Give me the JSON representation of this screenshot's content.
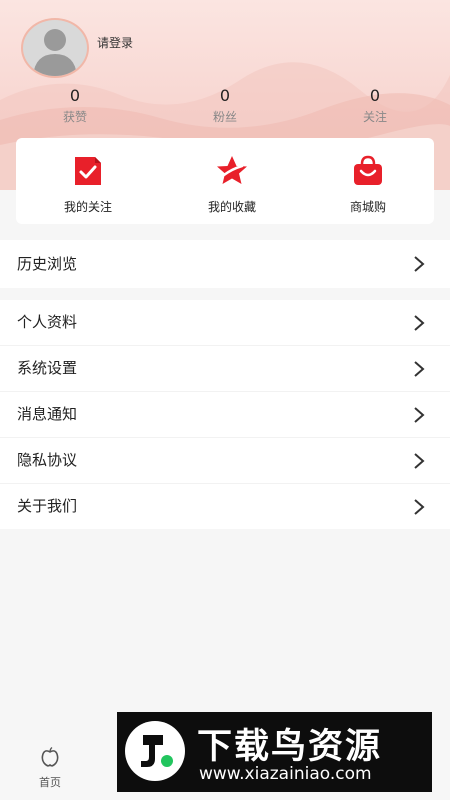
{
  "profile": {
    "login_prompt": "请登录"
  },
  "stats": [
    {
      "value": "0",
      "label": "获赞"
    },
    {
      "value": "0",
      "label": "粉丝"
    },
    {
      "value": "0",
      "label": "关注"
    }
  ],
  "quick_actions": [
    {
      "label": "我的关注",
      "icon": "check-document-icon"
    },
    {
      "label": "我的收藏",
      "icon": "star-icon"
    },
    {
      "label": "商城购",
      "icon": "shopping-bag-icon"
    }
  ],
  "history": {
    "label": "历史浏览"
  },
  "menu": [
    {
      "label": "个人资料"
    },
    {
      "label": "系统设置"
    },
    {
      "label": "消息通知"
    },
    {
      "label": "隐私协议"
    },
    {
      "label": "关于我们"
    }
  ],
  "tabbar": {
    "home_label": "首页"
  },
  "watermark": {
    "title": "下载鸟资源",
    "url": "www.xiazainiao.com"
  },
  "colors": {
    "accent": "#e8202a",
    "hero_bg": "#f8d7d2"
  }
}
